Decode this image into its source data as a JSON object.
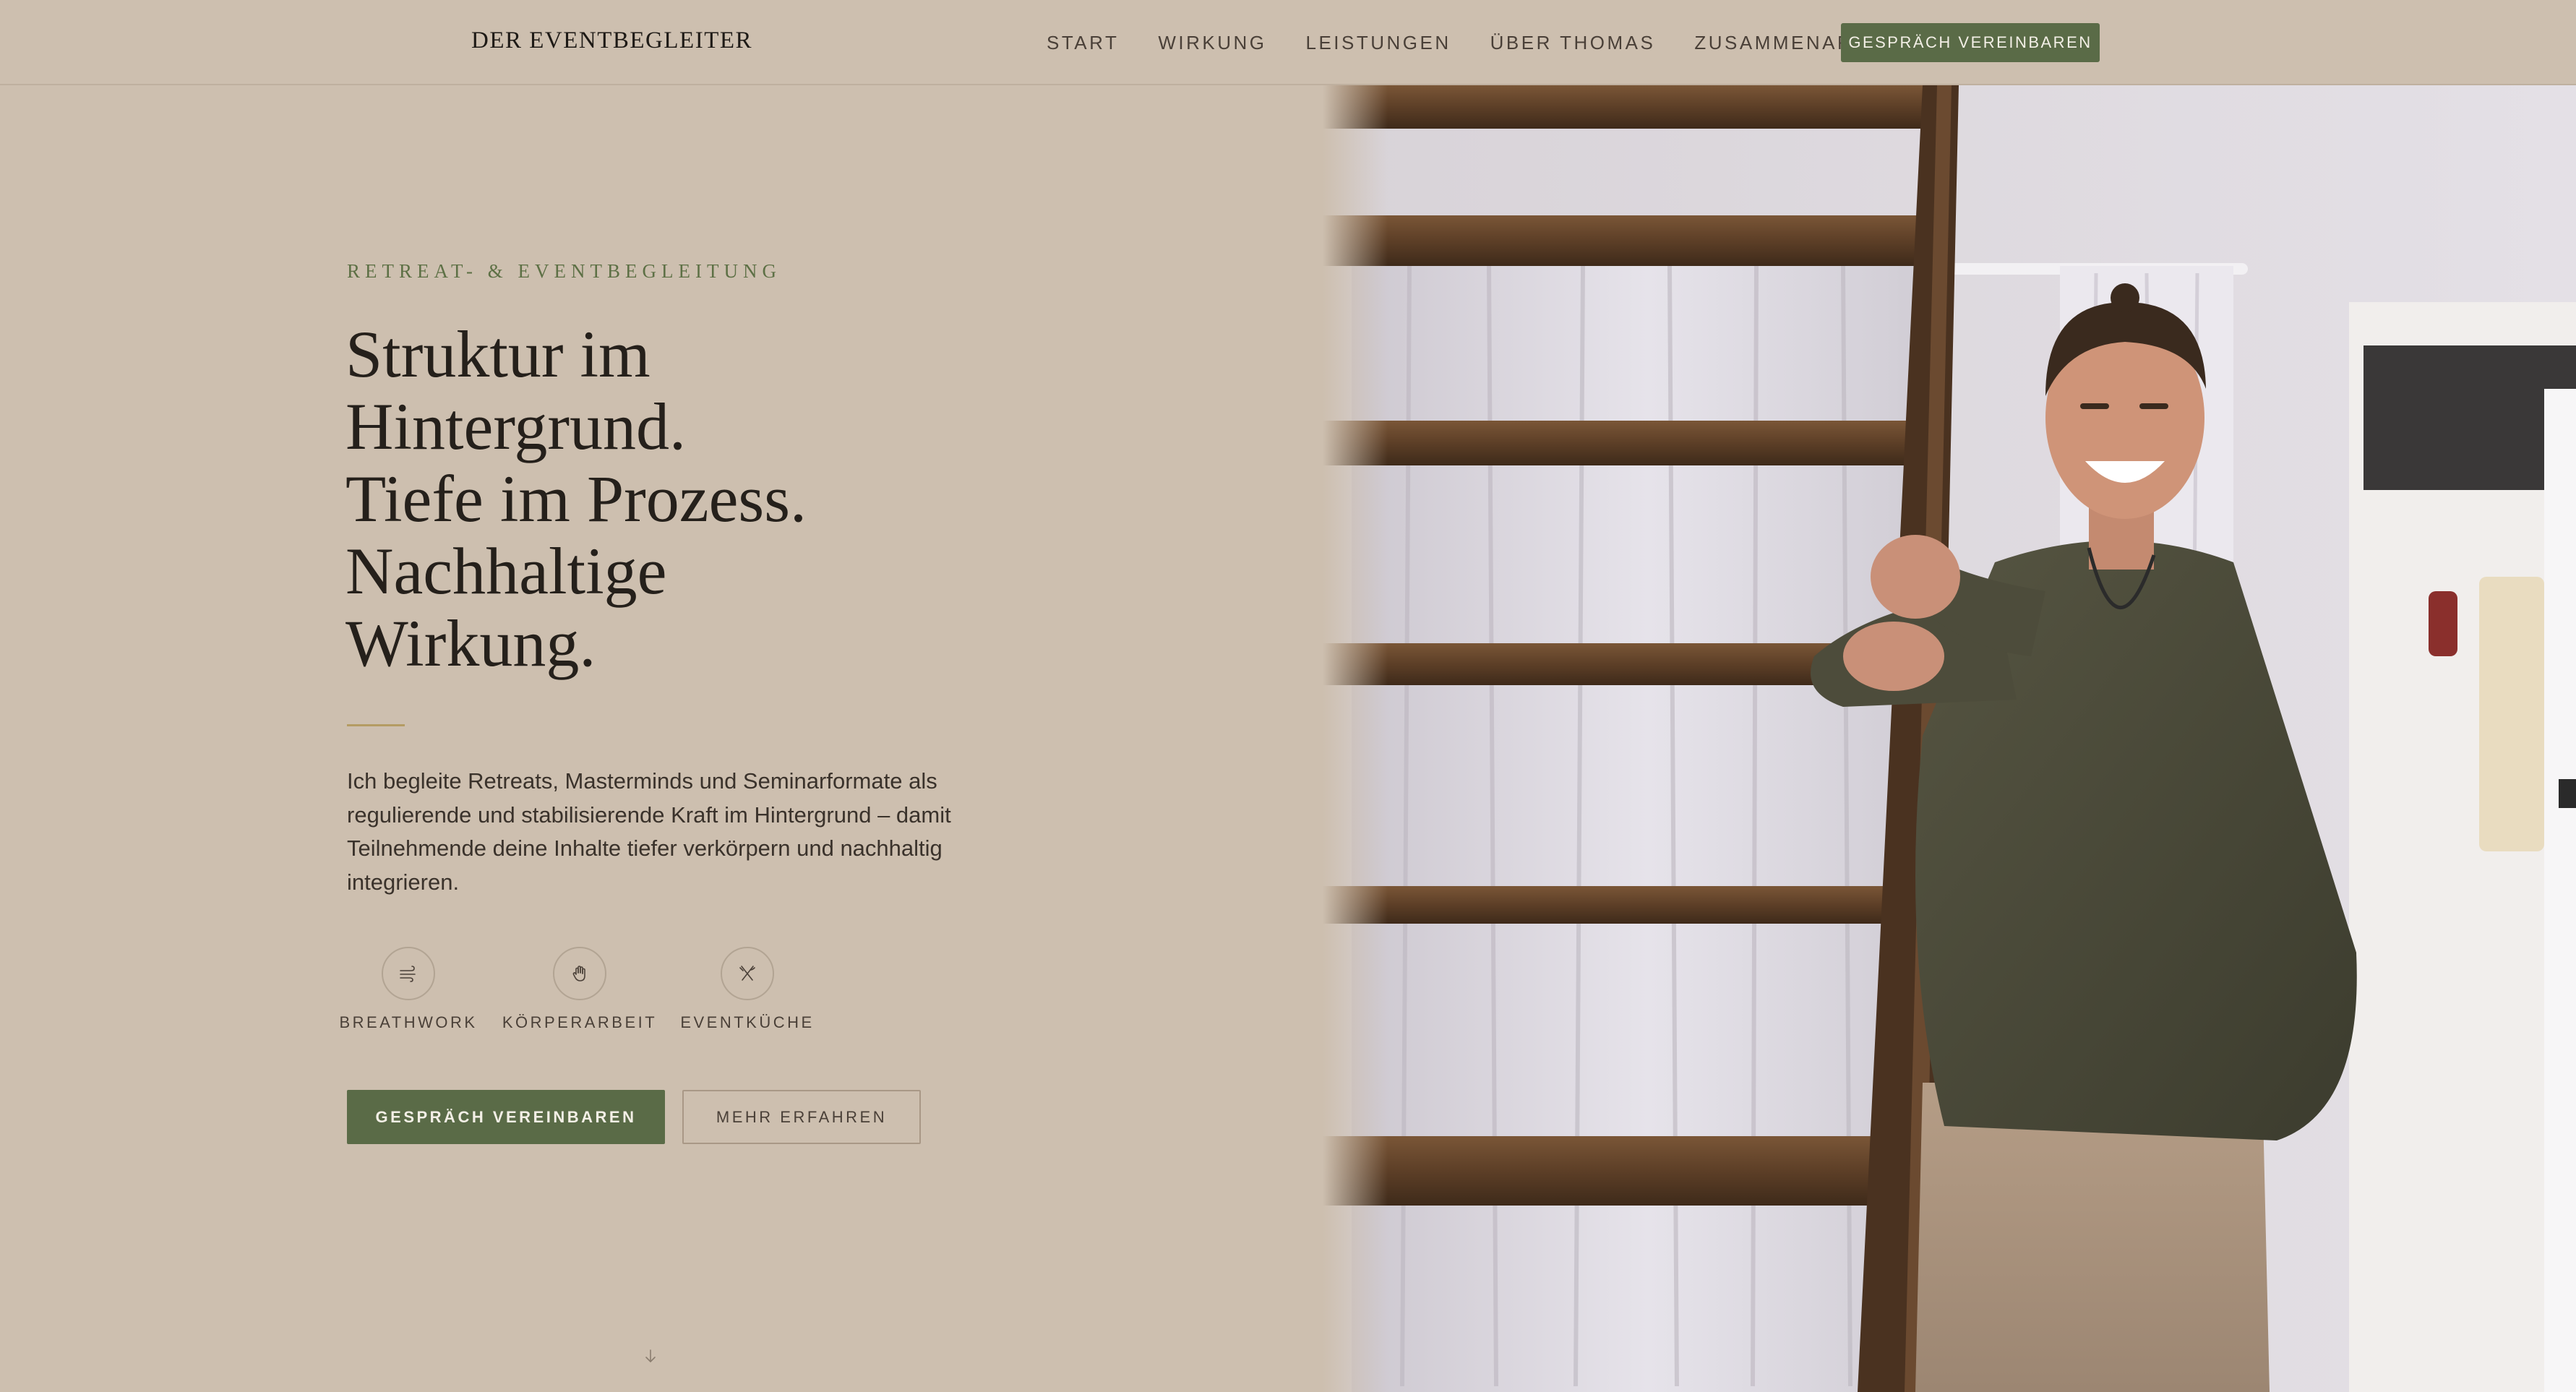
{
  "header": {
    "brand": "DER EVENTBEGLEITER",
    "nav": [
      "START",
      "WIRKUNG",
      "LEISTUNGEN",
      "ÜBER THOMAS",
      "ZUSAMMENARBEIT"
    ],
    "cta": "GESPRÄCH VEREINBAREN"
  },
  "hero": {
    "eyebrow": "RETREAT- & EVENTBEGLEITUNG",
    "headline": [
      "Struktur im",
      "Hintergrund.",
      "Tiefe im Prozess.",
      "Nachhaltige",
      "Wirkung."
    ],
    "intro": "Ich begleite Retreats, Masterminds und Seminarformate als regulierende und stabilisierende Kraft im Hintergrund – damit Teilnehmende deine Inhalte tiefer verkörpern und nachhaltig integrieren.",
    "features": [
      {
        "label": "BREATHWORK",
        "icon": "wind-icon"
      },
      {
        "label": "KÖRPERARBEIT",
        "icon": "hand-icon"
      },
      {
        "label": "EVENTKÜCHE",
        "icon": "utensils-icon"
      }
    ],
    "primary_button": "GESPRÄCH VEREINBAREN",
    "secondary_button": "MEHR ERFAHREN",
    "scroll_icon": "arrow-down-icon"
  },
  "colors": {
    "background": "#cdbfaf",
    "accent_green": "#5a6b47",
    "eyebrow_green": "#5d7045",
    "divider_gold": "#b49c63",
    "heading": "#25201b"
  }
}
